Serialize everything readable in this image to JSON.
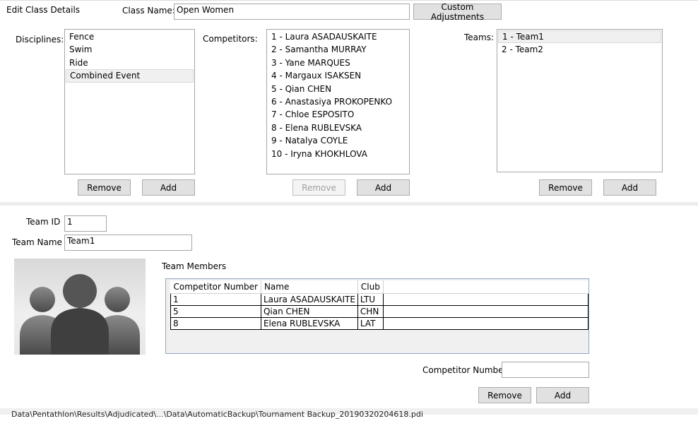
{
  "header": {
    "title": "Edit Class Details",
    "class_name_label": "Class Name:",
    "class_name_value": "Open Women",
    "custom_adjustments_label": "Custom Adjustments"
  },
  "disciplines": {
    "label": "Disciplines:",
    "items": [
      {
        "label": "Fence"
      },
      {
        "label": "Swim"
      },
      {
        "label": "Ride"
      },
      {
        "label": "Combined Event"
      }
    ],
    "selected": "Combined Event",
    "remove_label": "Remove",
    "add_label": "Add"
  },
  "competitors": {
    "label": "Competitors:",
    "items": [
      {
        "label": "1 - Laura ASADAUSKAITE"
      },
      {
        "label": "2 - Samantha MURRAY"
      },
      {
        "label": "3 - Yane MARQUES"
      },
      {
        "label": "4 - Margaux ISAKSEN"
      },
      {
        "label": "5 - Qian CHEN"
      },
      {
        "label": "6 - Anastasiya PROKOPENKO"
      },
      {
        "label": "7 - Chloe ESPOSITO"
      },
      {
        "label": "8 - Elena RUBLEVSKA"
      },
      {
        "label": "9 - Natalya COYLE"
      },
      {
        "label": "10 - Iryna KHOKHLOVA"
      }
    ],
    "remove_label": "Remove",
    "add_label": "Add"
  },
  "teams": {
    "label": "Teams:",
    "items": [
      {
        "label": "1 - Team1"
      },
      {
        "label": "2 - Team2"
      }
    ],
    "selected": "1 - Team1",
    "remove_label": "Remove",
    "add_label": "Add"
  },
  "team_detail": {
    "team_id_label": "Team ID",
    "team_id_value": "1",
    "team_name_label": "Team Name",
    "team_name_value": "Team1",
    "members_label": "Team Members",
    "columns": [
      "Competitor Number",
      "Name",
      "Club"
    ],
    "rows": [
      {
        "number": "1",
        "name": "Laura ASADAUSKAITE",
        "club": "LTU"
      },
      {
        "number": "5",
        "name": "Qian CHEN",
        "club": "CHN"
      },
      {
        "number": "8",
        "name": "Elena RUBLEVSKA",
        "club": "LAT"
      }
    ],
    "competitor_number_label": "Competitor Number",
    "competitor_number_value": "",
    "remove_label": "Remove",
    "add_label": "Add"
  },
  "status_bar": {
    "text": "Data\\Pentathlon\\Results\\Adjudicated\\...\\Data\\AutomaticBackup\\Tournament Backup_20190320204618.pdi"
  }
}
